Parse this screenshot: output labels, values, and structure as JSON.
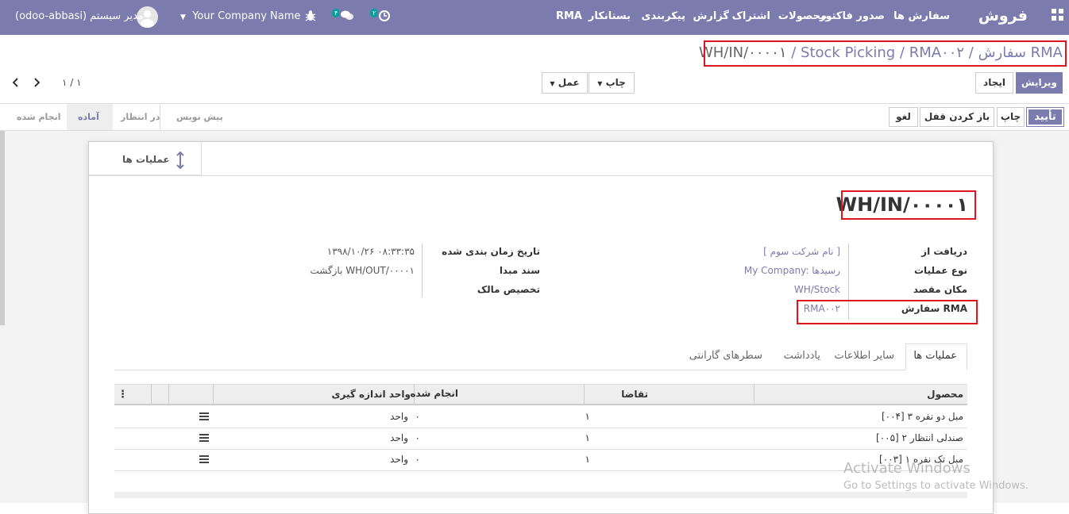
{
  "topbar": {
    "brand": "فروش",
    "menu": [
      "سفارش ها",
      "صدور فاکتور",
      "محصولات",
      "اشتراک",
      "گزارش",
      "پیکربندی",
      "بستانکار",
      "RMA"
    ],
    "activity_badge": "۲",
    "messages_badge": "۴",
    "company": "Your Company Name",
    "user": "مدیر سیستم (odoo-abbasi)"
  },
  "breadcrumb": {
    "part1": "سفارش RMA",
    "part2": "RMA۰۰۲",
    "part3": "Stock Picking",
    "current": "WH/IN/۰۰۰۰۱",
    "sep": " / "
  },
  "toolbar": {
    "edit": "ویرایش",
    "create": "ایجاد",
    "print": "چاپ",
    "action": "عمل",
    "pager": "۱ / ۱"
  },
  "statusbar": {
    "confirm": "تأیید",
    "print": "چاپ",
    "unlock": "باز کردن قفل",
    "cancel": "لغو",
    "stages": [
      "پیش نویس",
      "در انتظار",
      "آماده",
      "انجام شده"
    ],
    "active_stage": "آماده"
  },
  "sheet": {
    "smart_button": "عملیات ها",
    "title": "WH/IN/۰۰۰۰۱",
    "left": {
      "receive_from_label": "دریافت از",
      "receive_from_value": "[ نام شرکت سوم ]",
      "op_type_label": "نوع عملیات",
      "op_type_value": "My Company: رسیدها",
      "dest_label": "مکان مقصد",
      "dest_value": "WH/Stock",
      "rma_label": "سفارش RMA",
      "rma_value": "RMA۰۰۲"
    },
    "right": {
      "sched_label": "تاریخ زمان بندی شده",
      "sched_value": "۱۳۹۸/۱۰/۲۶ ۰۸:۳۳:۳۵",
      "origin_label": "سند مبدا",
      "origin_value": "بازگشت WH/OUT/۰۰۰۰۱",
      "owner_label": "تخصیص مالک"
    },
    "tabs": [
      "عملیات ها",
      "سایر اطلاعات",
      "یادداشت",
      "سطرهای گارانتی"
    ],
    "table": {
      "headers": [
        "محصول",
        "تقاضا",
        "انجام شده",
        "واحد اندازه گیری"
      ],
      "rows": [
        {
          "product": "[۰۰۴] مبل دو نفره ۳",
          "demand": "۱",
          "done": "۰",
          "uom": "واحد"
        },
        {
          "product": "[۰۰۵] صندلی انتظار ۲",
          "demand": "۱",
          "done": "۰",
          "uom": "واحد"
        },
        {
          "product": "[۰۰۳] مبل تک نفره ۱",
          "demand": "۱",
          "done": "۰",
          "uom": "واحد"
        }
      ]
    }
  },
  "watermark": {
    "line1": "Activate Windows",
    "line2": "Go to Settings to activate Windows."
  }
}
